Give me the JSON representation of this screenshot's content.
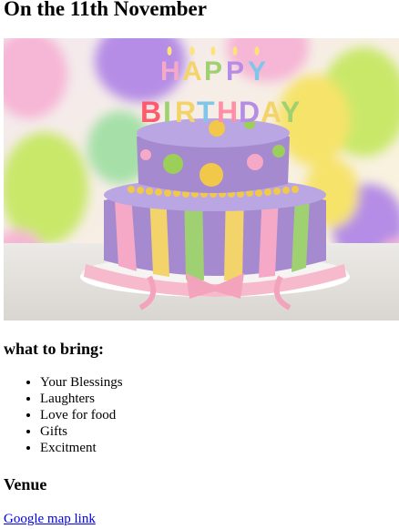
{
  "page": {
    "heading": "On the 11th November"
  },
  "hero_image": {
    "icon": "birthday-cake-photo",
    "candle_letters": [
      "H",
      "A",
      "P",
      "P",
      "Y",
      "B",
      "I",
      "R",
      "T",
      "H",
      "D",
      "A",
      "Y"
    ],
    "colors": {
      "cake_purple": "#a58ad0",
      "cake_lavender": "#b9a6e2",
      "stripe_yellow": "#f3d46a",
      "stripe_green": "#9fd072",
      "stripe_pink": "#f5a9c6",
      "ribbon_pink": "#f7b9cc",
      "dot_green": "#9ccf59",
      "dot_yellow": "#f2c84b",
      "balloon_green": "#c9e86a",
      "balloon_purple": "#b58de6",
      "balloon_yellow": "#f6e36a",
      "balloon_pink": "#f6b6d5"
    }
  },
  "bring": {
    "heading": "what to bring:",
    "items": [
      "Your Blessings",
      "Laughters",
      "Love for food",
      "Gifts",
      "Excitment"
    ]
  },
  "venue": {
    "heading": "Venue",
    "link_text": "Google map link"
  }
}
